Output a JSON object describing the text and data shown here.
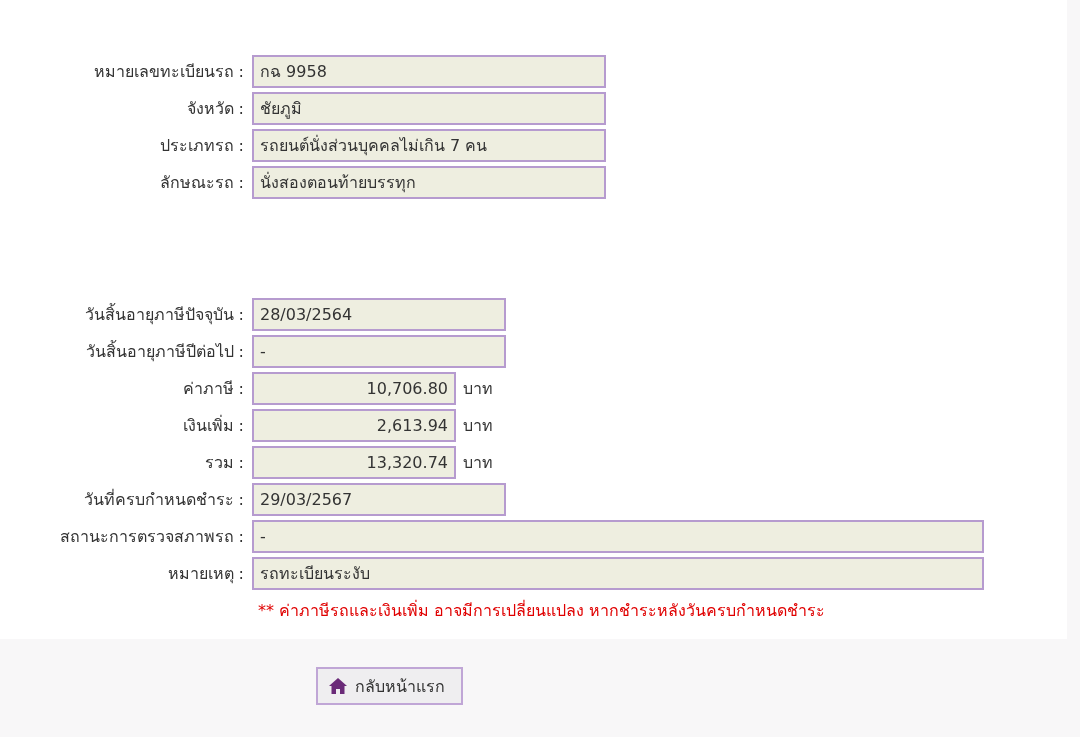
{
  "vehicle_fields": [
    {
      "label": "หมายเลขทะเบียนรถ :",
      "value": "กฉ 9958",
      "kind": "wide"
    },
    {
      "label": "จังหวัด :",
      "value": "ชัยภูมิ",
      "kind": "wide"
    },
    {
      "label": "ประเภทรถ :",
      "value": "รถยนต์นั่งส่วนบุคคลไม่เกิน 7 คน",
      "kind": "wide"
    },
    {
      "label": "ลักษณะรถ :",
      "value": "นั่งสองตอนท้ายบรรทุก",
      "kind": "wide"
    }
  ],
  "tax_fields": [
    {
      "label": "วันสิ้นอายุภาษีปัจจุบัน :",
      "value": "28/03/2564",
      "kind": "medium"
    },
    {
      "label": "วันสิ้นอายุภาษีปีต่อไป :",
      "value": "-",
      "kind": "medium"
    },
    {
      "label": "ค่าภาษี :",
      "value": "10,706.80",
      "kind": "amount",
      "unit": "บาท"
    },
    {
      "label": "เงินเพิ่ม :",
      "value": "2,613.94",
      "kind": "amount",
      "unit": "บาท"
    },
    {
      "label": "รวม :",
      "value": "13,320.74",
      "kind": "amount",
      "unit": "บาท"
    },
    {
      "label": "วันที่ครบกำหนดชำระ :",
      "value": "29/03/2567",
      "kind": "medium"
    },
    {
      "label": "สถานะการตรวจสภาพรถ :",
      "value": "-",
      "kind": "full"
    },
    {
      "label": "หมายเหตุ :",
      "value": "รถทะเบียนระงับ",
      "kind": "full"
    }
  ],
  "note": "** ค่าภาษีรถและเงินเพิ่ม อาจมีการเปลี่ยนแปลง หากชำระหลังวันครบกำหนดชำระ",
  "back_button": "กลับหน้าแรก"
}
